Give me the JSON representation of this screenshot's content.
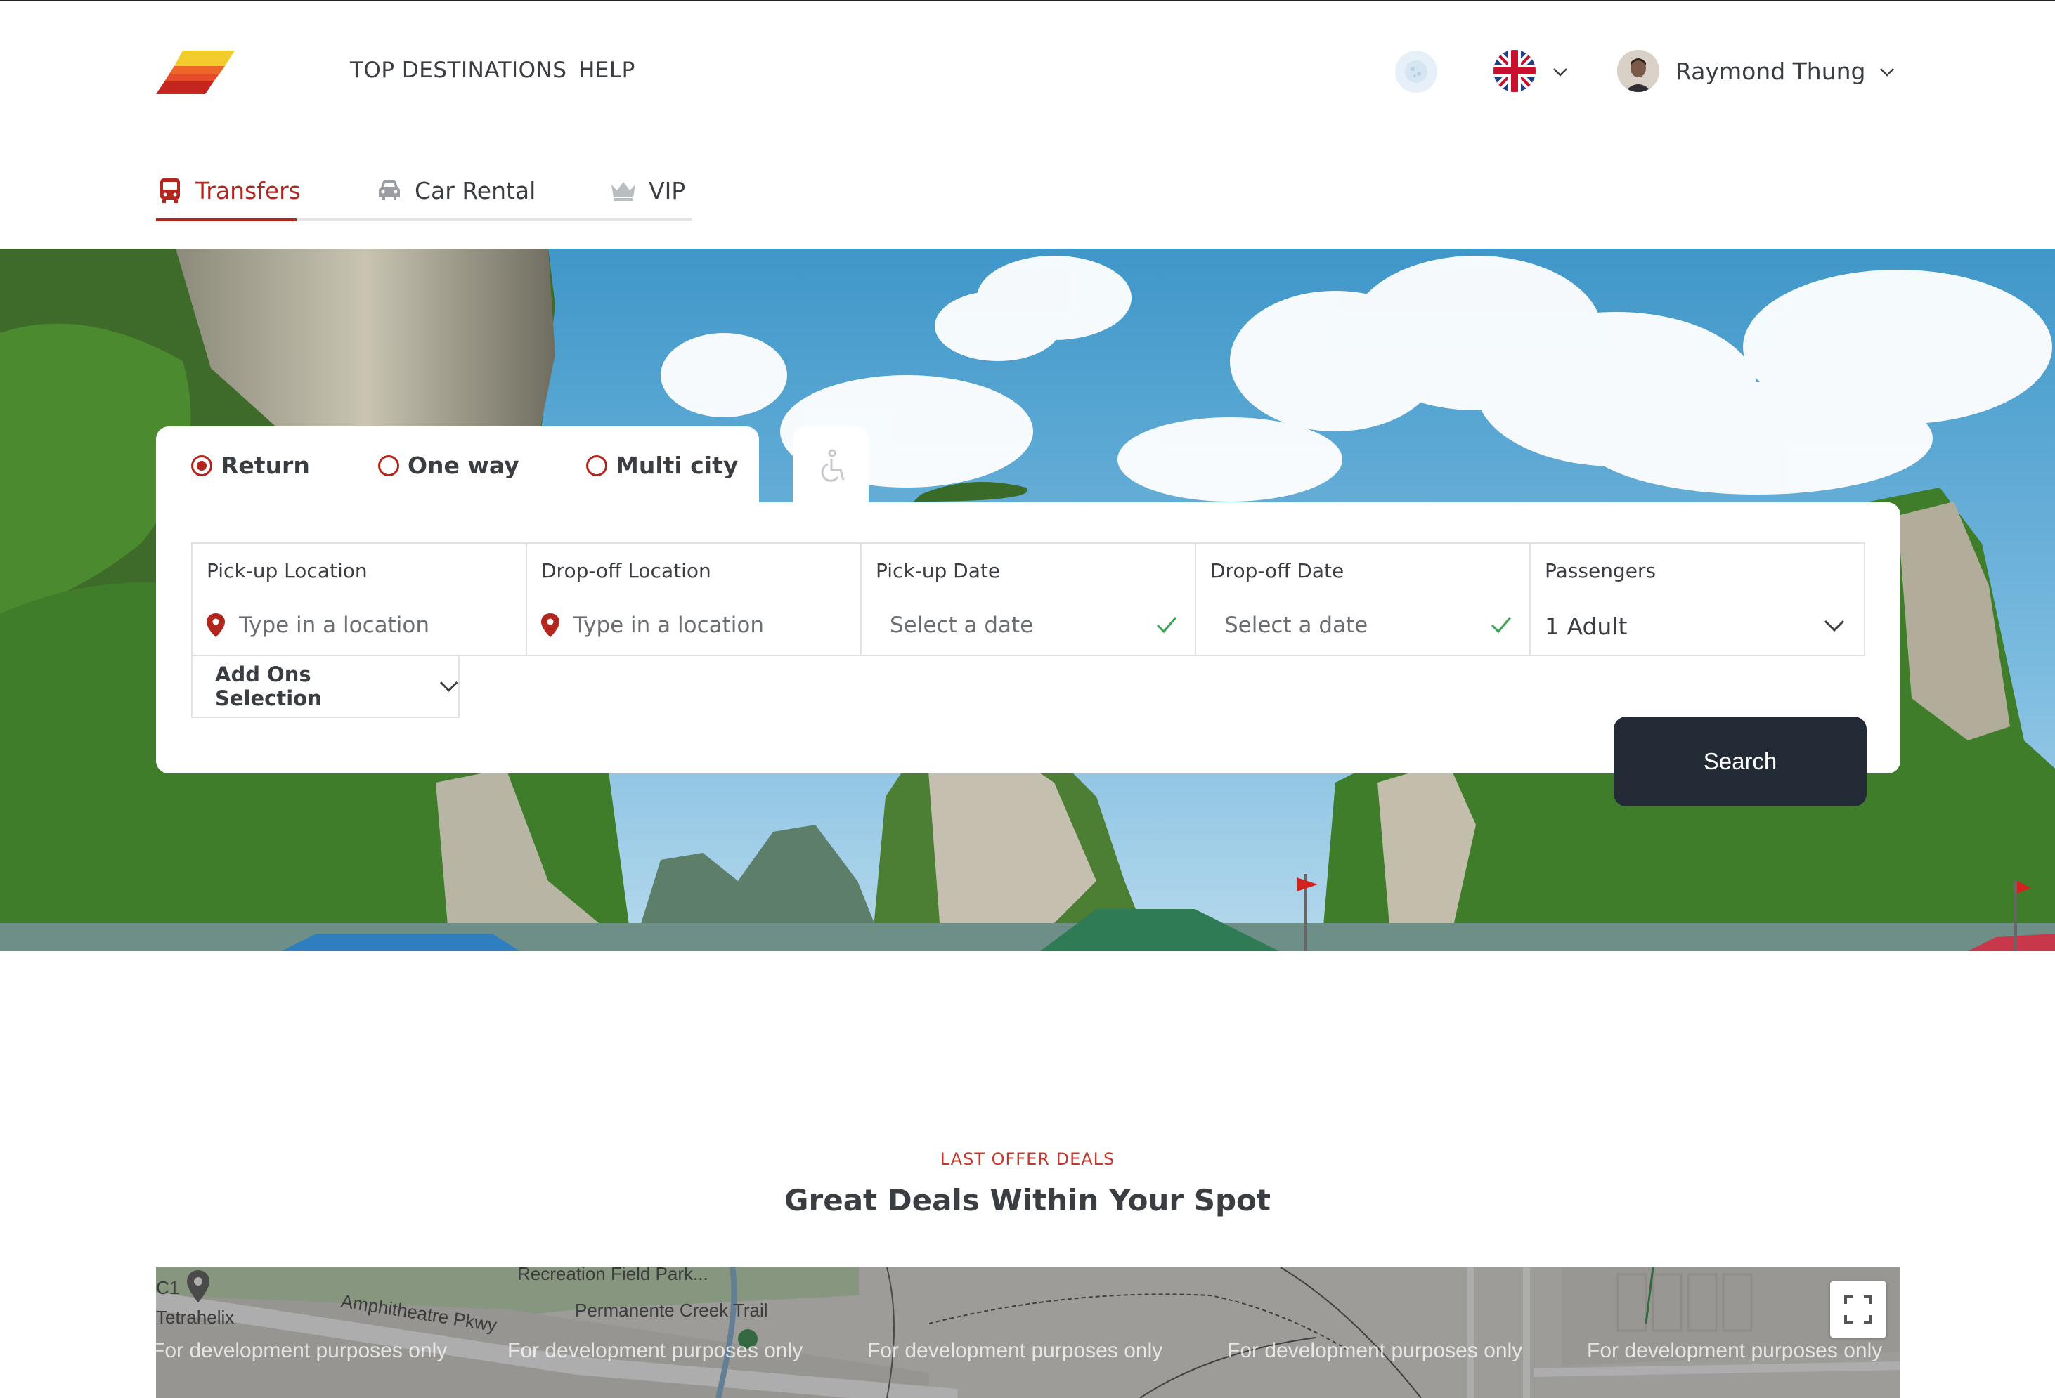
{
  "header": {
    "nav": {
      "top_destinations": "TOP DESTINATIONS",
      "help": "HELP"
    },
    "user": {
      "name": "Raymond Thung"
    },
    "language": "uk-flag-icon"
  },
  "service_tabs": [
    {
      "label": "Transfers",
      "icon": "bus-icon",
      "active": true
    },
    {
      "label": "Car Rental",
      "icon": "car-icon",
      "active": false
    },
    {
      "label": "VIP",
      "icon": "crown-icon",
      "active": false
    }
  ],
  "trip_type": {
    "options": [
      {
        "label": "Return",
        "checked": true
      },
      {
        "label": "One way",
        "checked": false
      },
      {
        "label": "Multi city",
        "checked": false
      }
    ]
  },
  "search": {
    "pickup_location": {
      "label": "Pick-up Location",
      "placeholder": "Type in a location"
    },
    "dropoff_location": {
      "label": "Drop-off Location",
      "placeholder": "Type in a location"
    },
    "pickup_date": {
      "label": "Pick-up Date",
      "value": "Select a date"
    },
    "dropoff_date": {
      "label": "Drop-off Date",
      "value": "Select a date"
    },
    "passengers": {
      "label": "Passengers",
      "value": "1 Adult"
    },
    "addons_label": "Add Ons Selection",
    "button_label": "Search"
  },
  "deals": {
    "eyebrow": "LAST OFFER DEALS",
    "title": "Great Deals Within Your Spot"
  },
  "map": {
    "watermark": "For development purposes only",
    "labels": {
      "recreation_park": "Recreation Field Park...",
      "amphitheatre": "Amphitheatre Pkwy",
      "creek_trail": "Permanente Creek Trail",
      "tetrahelix": "Tetrahelix",
      "c1": "C1"
    }
  },
  "colors": {
    "accent": "#b3261e",
    "button_dark": "#232b36",
    "text": "#3a3d42",
    "eyebrow": "#c4372a"
  }
}
